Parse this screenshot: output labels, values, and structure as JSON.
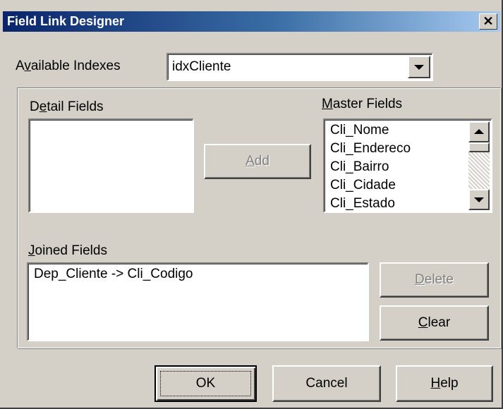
{
  "window": {
    "title": "Field Link Designer",
    "close_glyph": "✕"
  },
  "available_indexes": {
    "label_pre": "A",
    "label_key": "v",
    "label_post": "ailable Indexes",
    "value": "idxCliente"
  },
  "detail_fields": {
    "label_pre": "D",
    "label_key": "e",
    "label_post": "tail Fields",
    "items": []
  },
  "master_fields": {
    "label_pre": "",
    "label_key": "M",
    "label_post": "aster Fields",
    "items": [
      "Cli_Nome",
      "Cli_Endereco",
      "Cli_Bairro",
      "Cli_Cidade",
      "Cli_Estado"
    ]
  },
  "add_button": {
    "label_pre": "",
    "label_key": "A",
    "label_post": "dd",
    "enabled": false
  },
  "joined_fields": {
    "label_pre": "",
    "label_key": "J",
    "label_post": "oined Fields",
    "items": [
      "Dep_Cliente -> Cli_Codigo"
    ]
  },
  "delete_button": {
    "label_pre": "",
    "label_key": "D",
    "label_post": "elete",
    "enabled": false
  },
  "clear_button": {
    "label_pre": "",
    "label_key": "C",
    "label_post": "lear"
  },
  "footer": {
    "ok_label": "OK",
    "cancel_label": "Cancel",
    "help_pre": "",
    "help_key": "H",
    "help_post": "elp"
  },
  "colors": {
    "face": "#d4d0c8",
    "title_start": "#0a246a",
    "title_end": "#a6caf0",
    "disabled_text": "#808080"
  }
}
